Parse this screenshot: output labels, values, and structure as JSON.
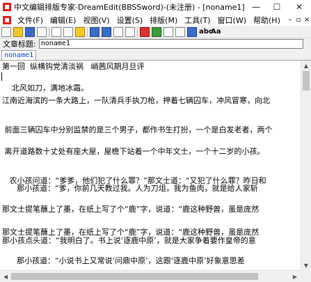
{
  "window": {
    "title": "中文编辑排版专家-DreamEdit(BBSSword)-(未注册) - [noname1]",
    "controls": {
      "minimize": "—",
      "maximize": "☐",
      "close": "✕"
    }
  },
  "menu": {
    "items": [
      "文件(F)",
      "编辑(E)",
      "视图(V)",
      "设置(S)",
      "排版(M)",
      "工具(T)",
      "窗口(W)",
      "帮助(H)"
    ],
    "mdi_controls": [
      "–",
      "▫",
      "×"
    ]
  },
  "toolbar": {
    "buttons": [
      "new-icon",
      "open-icon",
      "save-icon",
      "print-icon",
      "cut-icon",
      "copy-icon",
      "paste-icon",
      "undo-icon",
      "redo-icon",
      "find-icon",
      "replace-icon",
      "format-icon",
      "layout-icon",
      "indent-icon",
      "outdent-icon",
      "wrap-icon",
      "abc-icon",
      "text-A-icon",
      "fonts-icon"
    ],
    "abc_label": "abc",
    "font_label": "Aa"
  },
  "doc_title": {
    "label": "文章标题:",
    "value": "noname1"
  },
  "tabs": [
    {
      "label": "noname1"
    }
  ],
  "editor": {
    "lines": [
      "第一回  纵横钩党清淡祸   峭茜风期月旦评",
      "    北风如刀，满地冰霜。",
      "江南近海滨的一条大路上，一队清兵手执刀枪，押着七辆囚车，冲风冒寒，向北",
      " 前面三辆囚车中分别监禁的是三个男子，都作书生打扮，一个是白发老者，两个",
      " 离开道路数十丈处有座大屋，屋檐下站着一个中年文士，一个十二岁的小孩。",
      "   农小孩问道：“爹爹，他们犯了什么罪？”那文士道：“又犯了什么罪？昨日和",
      "      那小孩道：“爹，你前几天教过我。人为刀俎，我为鱼肉，就是给人家斩",
      "那文士提笔蘸上了墨，在纸上写了个“鹿”字，说道：“鹿这种野兽，虽是庞然",
      "那文士提笔蘸上了墨，在纸上写了个“鹿”字，说道：“鹿这种野兽，虽是庞然",
      "那小孩点头道：“我明白了。书上说‘逐鹿中原’，就是大家争着要作皇帝的意",
      "      那小孩道：“小说书上又常说‘问鼎中原’，这跟‘逐鹿中原’好象意思差"
    ]
  }
}
